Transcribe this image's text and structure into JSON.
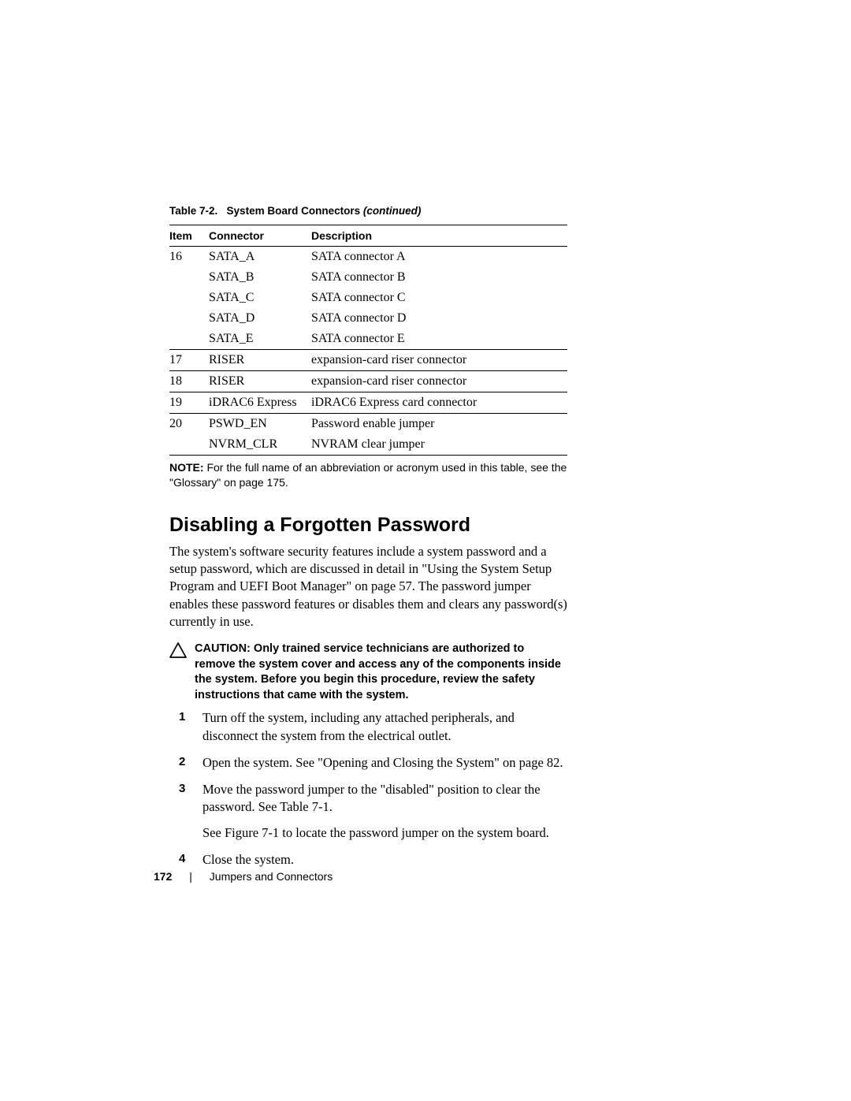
{
  "table": {
    "caption_prefix": "Table 7-2.",
    "caption_title": "System Board Connectors",
    "caption_suffix": "(continued)",
    "headers": {
      "item": "Item",
      "connector": "Connector",
      "description": "Description"
    },
    "rows": [
      {
        "item": "16",
        "connector": "SATA_A",
        "description": "SATA connector A",
        "sep": false
      },
      {
        "item": "",
        "connector": "SATA_B",
        "description": "SATA connector B",
        "sep": false
      },
      {
        "item": "",
        "connector": "SATA_C",
        "description": "SATA connector C",
        "sep": false
      },
      {
        "item": "",
        "connector": "SATA_D",
        "description": "SATA connector D",
        "sep": false
      },
      {
        "item": "",
        "connector": "SATA_E",
        "description": "SATA connector E",
        "sep": false
      },
      {
        "item": "17",
        "connector": "RISER",
        "description": "expansion-card riser connector",
        "sep": true
      },
      {
        "item": "18",
        "connector": "RISER",
        "description": "expansion-card riser connector",
        "sep": true
      },
      {
        "item": "19",
        "connector": "iDRAC6 Express",
        "description": "iDRAC6 Express card connector",
        "sep": true
      },
      {
        "item": "20",
        "connector": "PSWD_EN",
        "description": "Password enable jumper",
        "sep": true
      },
      {
        "item": "",
        "connector": "NVRM_CLR",
        "description": "NVRAM clear jumper",
        "sep": false,
        "last": true
      }
    ]
  },
  "note": {
    "label": "NOTE:",
    "text": "For the full name of an abbreviation or acronym used in this table, see the \"Glossary\" on page 175."
  },
  "section_heading": "Disabling a Forgotten Password",
  "body_paragraph": "The system's software security features include a system password and a setup password, which are discussed in detail in \"Using the System Setup Program and UEFI Boot Manager\" on page 57. The password jumper enables these password features or disables them and clears any password(s) currently in use.",
  "caution": {
    "label": "CAUTION:",
    "text": "Only trained service technicians are authorized to remove the system cover and access any of the components inside the system. Before you begin this procedure, review the safety instructions that came with the system."
  },
  "steps": [
    {
      "num": "1",
      "paragraphs": [
        "Turn off the system, including any attached peripherals, and disconnect the system from the electrical outlet."
      ]
    },
    {
      "num": "2",
      "paragraphs": [
        "Open the system. See \"Opening and Closing the System\" on page 82."
      ]
    },
    {
      "num": "3",
      "paragraphs": [
        "Move the password jumper to the \"disabled\" position to clear the password. See Table 7-1.",
        "See Figure 7-1 to locate the password jumper on the system board."
      ]
    },
    {
      "num": "4",
      "paragraphs": [
        "Close the system."
      ]
    }
  ],
  "footer": {
    "page_number": "172",
    "section": "Jumpers and Connectors"
  }
}
